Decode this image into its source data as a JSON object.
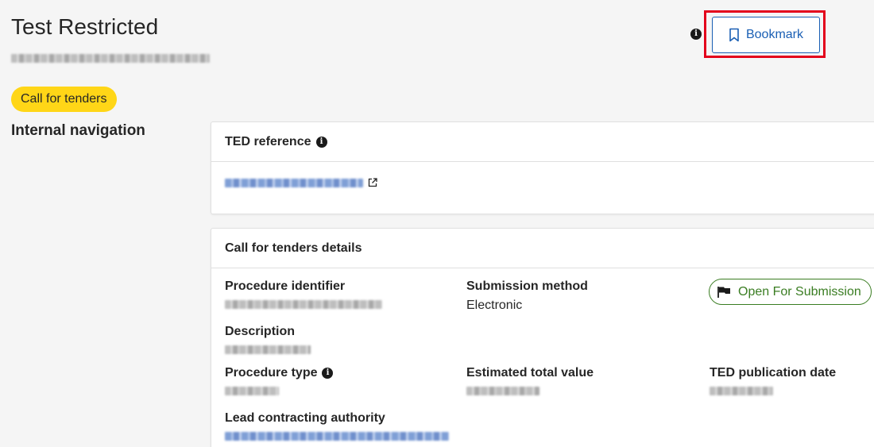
{
  "header": {
    "title": "Test Restricted",
    "bookmark_label": "Bookmark"
  },
  "status_pill": "Call for tenders",
  "internal_nav_title": "Internal navigation",
  "ted_reference": {
    "title": "TED reference"
  },
  "details": {
    "title": "Call for tenders details",
    "procedure_identifier_label": "Procedure identifier",
    "submission_method_label": "Submission method",
    "submission_method_value": "Electronic",
    "status_badge": "Open For Submission",
    "description_label": "Description",
    "procedure_type_label": "Procedure type",
    "estimated_total_value_label": "Estimated total value",
    "ted_publication_date_label": "TED publication date",
    "lead_contracting_authority_label": "Lead contracting authority"
  },
  "icons": {
    "info": "info-icon",
    "bookmark": "bookmark-icon",
    "external_link": "external-link-icon",
    "flag": "flag-icon"
  },
  "colors": {
    "primary_blue": "#1a5fb4",
    "pill_yellow": "#ffd617",
    "status_green": "#3a7d22",
    "highlight_red": "#e3001b"
  }
}
